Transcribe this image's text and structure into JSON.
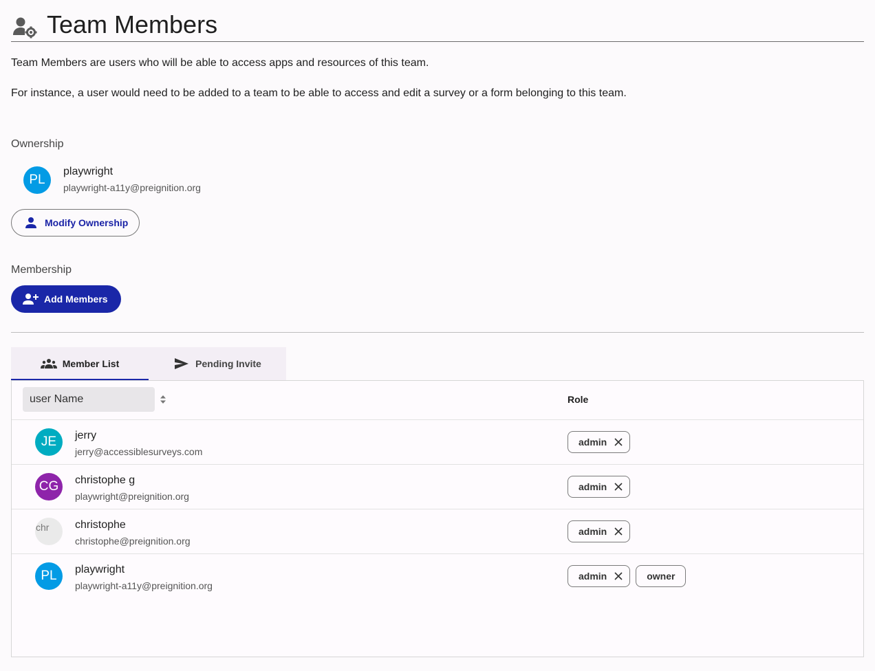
{
  "header": {
    "title": "Team Members"
  },
  "description": {
    "line1": "Team Members are users who will be able to access apps and resources of this team.",
    "line2": "For instance, a user would need to be added to a team to be able to access and edit a survey or a form belonging to this team."
  },
  "ownership": {
    "label": "Ownership",
    "owner": {
      "initials": "PL",
      "name": "playwright",
      "email": "playwright-a11y@preignition.org"
    },
    "modify_button": "Modify Ownership"
  },
  "membership": {
    "label": "Membership",
    "add_button": "Add Members"
  },
  "tabs": [
    {
      "label": "Member List",
      "icon": "group-icon",
      "active": true
    },
    {
      "label": "Pending Invite",
      "icon": "send-icon",
      "active": false
    }
  ],
  "table": {
    "sort_field_value": "user Name",
    "role_header": "Role",
    "rows": [
      {
        "initials": "JE",
        "name": "jerry",
        "email": "jerry@accessiblesurveys.com",
        "roles": [
          "admin"
        ],
        "avatar_color": "#00acc1"
      },
      {
        "initials": "CG",
        "name": "christophe g",
        "email": "playwright@preignition.org",
        "roles": [
          "admin"
        ],
        "avatar_color": "#8e24aa"
      },
      {
        "initials": "chr",
        "name": "christophe",
        "email": "christophe@preignition.org",
        "roles": [
          "admin"
        ],
        "avatar_color": "#eaeaea"
      },
      {
        "initials": "PL",
        "name": "playwright",
        "email": "playwright-a11y@preignition.org",
        "roles": [
          "admin"
        ],
        "extra_role": "owner",
        "avatar_color": "#039be5"
      }
    ]
  },
  "colors": {
    "primary": "#1a27a8",
    "background": "#fcfafc"
  }
}
